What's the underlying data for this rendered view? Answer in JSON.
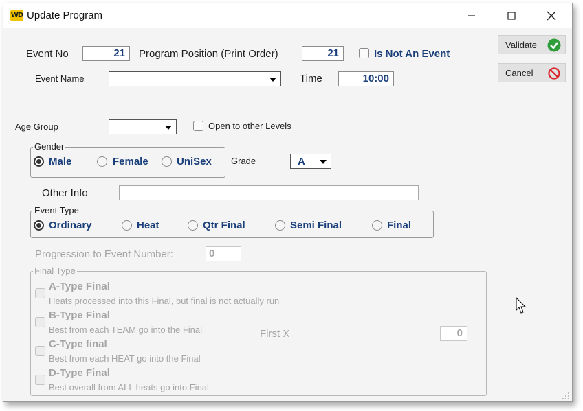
{
  "window": {
    "title": "Update Program",
    "app_icon_text": "WD"
  },
  "buttons": {
    "validate": "Validate",
    "cancel": "Cancel"
  },
  "event_no": {
    "label": "Event No",
    "value": "21"
  },
  "program_position": {
    "label": "Program Position (Print Order)",
    "value": "21"
  },
  "is_not_event": {
    "label": "Is Not An Event",
    "checked": false
  },
  "event_name": {
    "label": "Event Name",
    "value": ""
  },
  "time": {
    "label": "Time",
    "value": "10:00"
  },
  "age_group": {
    "label": "Age Group",
    "value": ""
  },
  "open_other_levels": {
    "label": "Open to other Levels",
    "checked": false
  },
  "gender": {
    "title": "Gender",
    "options": [
      "Male",
      "Female",
      "UniSex"
    ],
    "selected": "Male"
  },
  "grade": {
    "label": "Grade",
    "value": "A"
  },
  "other_info": {
    "label": "Other Info",
    "value": ""
  },
  "event_type": {
    "title": "Event Type",
    "options": [
      "Ordinary",
      "Heat",
      "Qtr Final",
      "Semi Final",
      "Final"
    ],
    "selected": "Ordinary"
  },
  "progression": {
    "label": "Progression to Event Number:",
    "value": "0"
  },
  "final_type": {
    "title": "Final Type",
    "items": [
      {
        "name": "A-Type Final",
        "desc": "Heats processed into this Final, but final is not actually run"
      },
      {
        "name": "B-Type Final",
        "desc": "Best from each TEAM go into the Final"
      },
      {
        "name": "C-Type final",
        "desc": "Best from each HEAT go into the Final"
      },
      {
        "name": "D-Type Final",
        "desc": "Best overall from ALL heats go into Final"
      }
    ],
    "first_x_label": "First X",
    "first_x_value": "0"
  },
  "colors": {
    "value_blue": "#1a3f7a",
    "validate_green": "#2e9d3a",
    "cancel_red": "#d9272e",
    "app_icon": "#f2c200"
  }
}
